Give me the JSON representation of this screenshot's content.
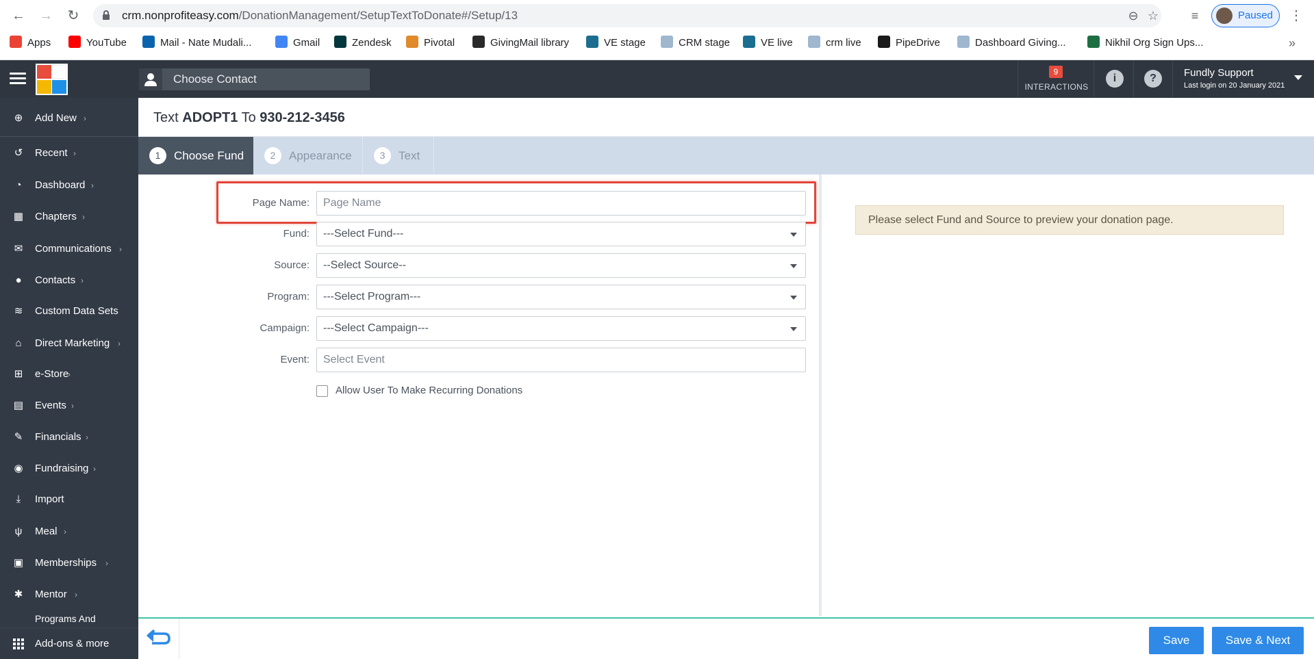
{
  "browser": {
    "url_host": "crm.nonprofiteasy.com",
    "url_path": "/DonationManagement/SetupTextToDonate#/Setup/13",
    "profile_label": "Paused",
    "bookmarks": [
      {
        "label": "Apps",
        "icon": "apps-grid-icon",
        "color": "#ea4335"
      },
      {
        "label": "YouTube",
        "icon": "youtube-icon",
        "color": "#ff0000"
      },
      {
        "label": "Mail - Nate Mudali...",
        "icon": "outlook-icon",
        "color": "#0a64ad"
      },
      {
        "label": "Gmail",
        "icon": "google-icon",
        "color": "#4285f4"
      },
      {
        "label": "Zendesk",
        "icon": "zendesk-icon",
        "color": "#03363d"
      },
      {
        "label": "Pivotal",
        "icon": "pivotal-icon",
        "color": "#e08a2c"
      },
      {
        "label": "GivingMail library",
        "icon": "givingmail-icon",
        "color": "#2a2a2a"
      },
      {
        "label": "VE stage",
        "icon": "ve-icon",
        "color": "#1b6e8f"
      },
      {
        "label": "CRM stage",
        "icon": "document-icon",
        "color": "#9fb7cf"
      },
      {
        "label": "VE live",
        "icon": "ve-icon",
        "color": "#1b6e8f"
      },
      {
        "label": "crm live",
        "icon": "document-icon",
        "color": "#9fb7cf"
      },
      {
        "label": "PipeDrive",
        "icon": "pipedrive-icon",
        "color": "#1a1a1a"
      },
      {
        "label": "Dashboard Giving...",
        "icon": "document-icon",
        "color": "#9fb7cf"
      },
      {
        "label": "Nikhil Org Sign Ups...",
        "icon": "excel-icon",
        "color": "#1d6f42"
      }
    ]
  },
  "header": {
    "choose_contact": "Choose Contact",
    "interactions_count": "9",
    "interactions_label": "INTERACTIONS",
    "user_name": "Fundly Support",
    "last_login": "Last login on 20 January 2021"
  },
  "sidebar": {
    "items": [
      {
        "label": "Add New",
        "icon": "plus-circle-icon",
        "glyph": "⊕",
        "chevron": true
      },
      {
        "label": "Recent",
        "icon": "history-icon",
        "glyph": "↺",
        "chevron": true
      },
      {
        "label": "Dashboard",
        "icon": "dashboard-icon",
        "glyph": "◔",
        "chevron": true
      },
      {
        "label": "Chapters",
        "icon": "grid-icon",
        "glyph": "▦",
        "chevron": true
      },
      {
        "label": "Communications",
        "icon": "envelope-icon",
        "glyph": "✉",
        "chevron": true
      },
      {
        "label": "Contacts",
        "icon": "user-icon",
        "glyph": "●",
        "chevron": true
      },
      {
        "label": "Custom Data Sets",
        "icon": "database-icon",
        "glyph": "≋",
        "chevron": false
      },
      {
        "label": "Direct Marketing",
        "icon": "bank-icon",
        "glyph": "⌂",
        "chevron": true
      },
      {
        "label": "e-Store",
        "icon": "cart-icon",
        "glyph": "⊞",
        "chevron": true
      },
      {
        "label": "Events",
        "icon": "calendar-icon",
        "glyph": "▤",
        "chevron": true
      },
      {
        "label": "Financials",
        "icon": "money-icon",
        "glyph": "✎",
        "chevron": true
      },
      {
        "label": "Fundraising",
        "icon": "moneybag-icon",
        "glyph": "◉",
        "chevron": true
      },
      {
        "label": "Import",
        "icon": "download-icon",
        "glyph": "⤓",
        "chevron": false
      },
      {
        "label": "Meal",
        "icon": "utensils-icon",
        "glyph": "ψ",
        "chevron": true
      },
      {
        "label": "Memberships",
        "icon": "id-card-icon",
        "glyph": "▣",
        "chevron": true
      },
      {
        "label": "Mentor",
        "icon": "mentor-icon",
        "glyph": "✱",
        "chevron": true
      },
      {
        "label": "Programs And",
        "icon": "programs-icon",
        "glyph": "",
        "chevron": false
      }
    ],
    "bottom_label": "Add-ons & more"
  },
  "page": {
    "title_prefix": "Text",
    "keyword": "ADOPT1",
    "title_mid": "To",
    "number": "930-212-3456"
  },
  "steps": [
    {
      "num": "1",
      "label": "Choose Fund",
      "active": true
    },
    {
      "num": "2",
      "label": "Appearance",
      "active": false
    },
    {
      "num": "3",
      "label": "Text",
      "active": false
    }
  ],
  "form": {
    "page_name_label": "Page Name:",
    "page_name_placeholder": "Page Name",
    "fund_label": "Fund:",
    "fund_value": "---Select Fund---",
    "source_label": "Source:",
    "source_value": "--Select Source--",
    "program_label": "Program:",
    "program_value": "---Select Program---",
    "campaign_label": "Campaign:",
    "campaign_value": "---Select Campaign---",
    "event_label": "Event:",
    "event_placeholder": "Select Event",
    "recurring_label": "Allow User To Make Recurring Donations",
    "highlight_color": "#e0463a"
  },
  "preview": {
    "message": "Please select Fund and Source to preview your donation page."
  },
  "footer": {
    "save_label": "Save",
    "save_next_label": "Save & Next"
  }
}
